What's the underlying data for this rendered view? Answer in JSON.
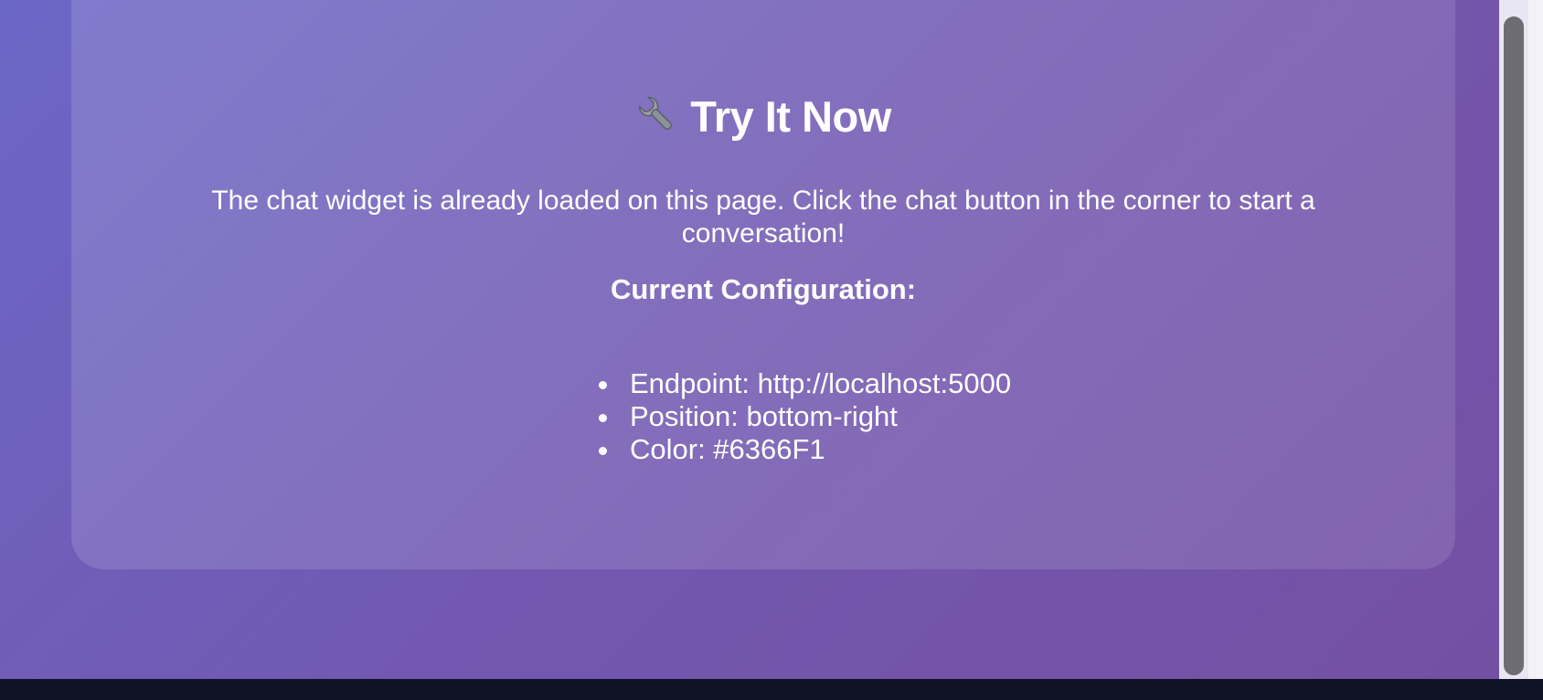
{
  "section": {
    "title": "Try It Now",
    "title_icon": "wrench-icon",
    "description": "The chat widget is already loaded on this page. Click the chat button in the corner to start a conversation!",
    "config_heading": "Current Configuration:",
    "config_items": [
      "Endpoint: http://localhost:5000",
      "Position: bottom-right",
      "Color: #6366F1"
    ]
  },
  "colors": {
    "accent": "#6366F1",
    "background_gradient_start": "#6b67c6",
    "background_gradient_end": "#7450a3",
    "text": "#ffffff"
  }
}
